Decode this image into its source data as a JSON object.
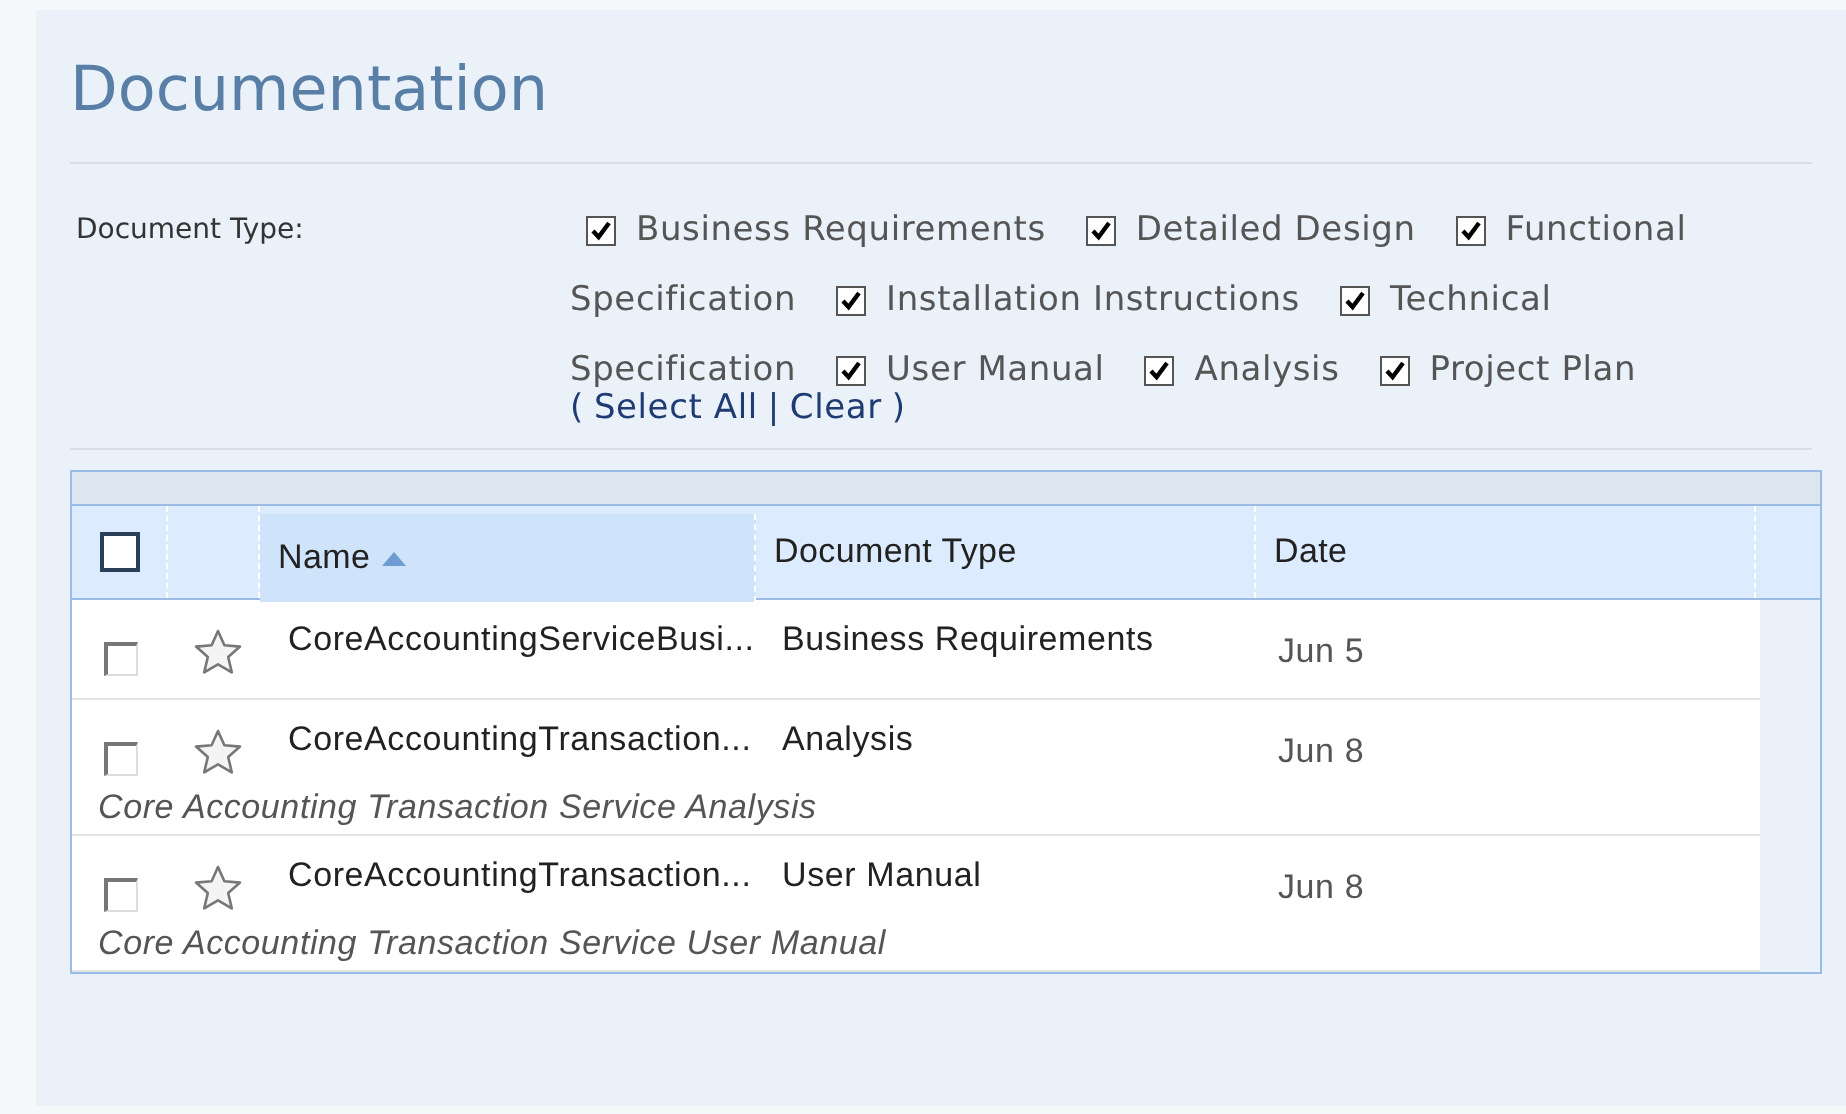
{
  "title": "Documentation",
  "filter": {
    "label": "Document Type:",
    "options": [
      {
        "label": "Business Requirements",
        "checked": true
      },
      {
        "label": "Detailed Design",
        "checked": true
      },
      {
        "label": "Functional",
        "label_continued": "Specification",
        "checked": true
      },
      {
        "label": "Installation Instructions",
        "checked": true
      },
      {
        "label": "Technical",
        "label_continued": "Specification",
        "checked": true
      },
      {
        "label": "User Manual",
        "checked": true
      },
      {
        "label": "Analysis",
        "checked": true
      },
      {
        "label": "Project Plan",
        "checked": true
      }
    ],
    "links": {
      "open": "(",
      "select_all": "Select All",
      "separator": "|",
      "clear": "Clear",
      "close": ")"
    }
  },
  "table": {
    "select_all_checked": false,
    "columns": [
      {
        "label": "Name",
        "sorted": true
      },
      {
        "label": "Document Type",
        "sorted": false
      },
      {
        "label": "Date",
        "sorted": false
      }
    ],
    "rows": [
      {
        "checked": false,
        "starred": false,
        "name": "CoreAccountingServiceBusi...",
        "document_type": "Business Requirements",
        "date": "Jun 5"
      },
      {
        "checked": false,
        "starred": false,
        "name": "CoreAccountingTransaction...",
        "document_type": "Analysis",
        "date": "Jun 8",
        "description": "Core Accounting Transaction Service Analysis"
      },
      {
        "checked": false,
        "starred": false,
        "name": "CoreAccountingTransaction...",
        "document_type": "User Manual",
        "date": "Jun 8",
        "description": "Core Accounting Transaction Service User Manual"
      }
    ]
  }
}
